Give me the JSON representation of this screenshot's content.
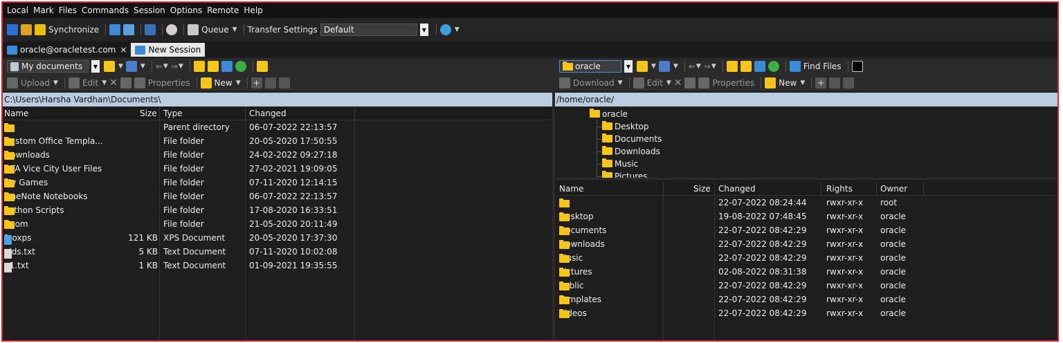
{
  "menu": [
    "Local",
    "Mark",
    "Files",
    "Commands",
    "Session",
    "Options",
    "Remote",
    "Help"
  ],
  "toolbar": {
    "synchronize": "Synchronize",
    "queue": "Queue",
    "transfer_settings": "Transfer Settings",
    "transfer_value": "Default"
  },
  "tabs": {
    "session": "oracle@oracletest.com",
    "close": "×",
    "new_session": "New Session"
  },
  "left": {
    "location": "My documents",
    "upload": "Upload",
    "edit": "Edit",
    "properties": "Properties",
    "new": "New",
    "path": "C:\\Users\\Harsha Vardhan\\Documents\\",
    "columns": {
      "name": "Name",
      "size": "Size",
      "type": "Type",
      "changed": "Changed"
    },
    "files": [
      {
        "name": "..",
        "size": "",
        "type": "Parent directory",
        "changed": "06-07-2022  22:13:57",
        "icon": "up"
      },
      {
        "name": "Custom Office Templa...",
        "size": "",
        "type": "File folder",
        "changed": "20-05-2020  17:50:55",
        "icon": "folder"
      },
      {
        "name": "Downloads",
        "size": "",
        "type": "File folder",
        "changed": "24-02-2022  09:27:18",
        "icon": "folder"
      },
      {
        "name": "GTA Vice City User Files",
        "size": "",
        "type": "File folder",
        "changed": "27-02-2021  19:09:05",
        "icon": "folder"
      },
      {
        "name": "My Games",
        "size": "",
        "type": "File folder",
        "changed": "07-11-2020  12:14:15",
        "icon": "folder"
      },
      {
        "name": "OneNote Notebooks",
        "size": "",
        "type": "File folder",
        "changed": "06-07-2022  22:13:57",
        "icon": "folder"
      },
      {
        "name": "Python Scripts",
        "size": "",
        "type": "File folder",
        "changed": "17-08-2020  16:33:51",
        "icon": "folder"
      },
      {
        "name": "Zoom",
        "size": "",
        "type": "File folder",
        "changed": "21-05-2020  20:11:49",
        "icon": "folder"
      },
      {
        "name": "1.oxps",
        "size": "121 KB",
        "type": "XPS Document",
        "changed": "20-05-2020  17:37:30",
        "icon": "xps"
      },
      {
        "name": "aids.txt",
        "size": "5 KB",
        "type": "Text Document",
        "changed": "07-11-2020  10:02:08",
        "icon": "txt"
      },
      {
        "name": "p1.txt",
        "size": "1 KB",
        "type": "Text Document",
        "changed": "01-09-2021  19:35:55",
        "icon": "txt"
      }
    ]
  },
  "right": {
    "location": "oracle",
    "find_files": "Find Files",
    "download": "Download",
    "edit": "Edit",
    "properties": "Properties",
    "new": "New",
    "path": "/home/oracle/",
    "tree": {
      "root": "oracle",
      "children": [
        "Desktop",
        "Documents",
        "Downloads",
        "Music",
        "Pictures"
      ]
    },
    "columns": {
      "name": "Name",
      "size": "Size",
      "changed": "Changed",
      "rights": "Rights",
      "owner": "Owner"
    },
    "files": [
      {
        "name": "..",
        "changed": "22-07-2022 08:24:44",
        "rights": "rwxr-xr-x",
        "owner": "root",
        "icon": "up"
      },
      {
        "name": "Desktop",
        "changed": "19-08-2022 07:48:45",
        "rights": "rwxr-xr-x",
        "owner": "oracle",
        "icon": "folder"
      },
      {
        "name": "Documents",
        "changed": "22-07-2022 08:42:29",
        "rights": "rwxr-xr-x",
        "owner": "oracle",
        "icon": "folder"
      },
      {
        "name": "Downloads",
        "changed": "22-07-2022 08:42:29",
        "rights": "rwxr-xr-x",
        "owner": "oracle",
        "icon": "folder"
      },
      {
        "name": "Music",
        "changed": "22-07-2022 08:42:29",
        "rights": "rwxr-xr-x",
        "owner": "oracle",
        "icon": "folder"
      },
      {
        "name": "Pictures",
        "changed": "02-08-2022 08:31:38",
        "rights": "rwxr-xr-x",
        "owner": "oracle",
        "icon": "folder"
      },
      {
        "name": "Public",
        "changed": "22-07-2022 08:42:29",
        "rights": "rwxr-xr-x",
        "owner": "oracle",
        "icon": "folder"
      },
      {
        "name": "Templates",
        "changed": "22-07-2022 08:42:29",
        "rights": "rwxr-xr-x",
        "owner": "oracle",
        "icon": "folder"
      },
      {
        "name": "Videos",
        "changed": "22-07-2022 08:42:29",
        "rights": "rwxr-xr-x",
        "owner": "oracle",
        "icon": "folder"
      }
    ]
  },
  "colors": {
    "frame": "#e0232e",
    "folder": "#f5c518",
    "path_bar": "#b8cde0",
    "background": "#1e1e1e"
  }
}
